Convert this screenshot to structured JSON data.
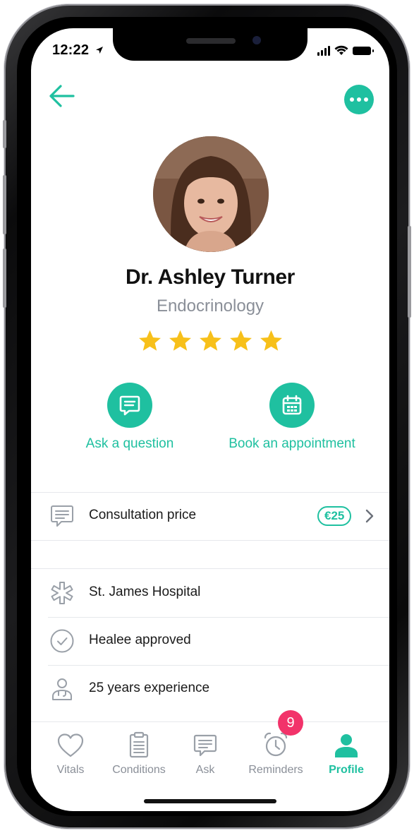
{
  "status_bar": {
    "time": "12:22"
  },
  "doctor": {
    "name": "Dr. Ashley Turner",
    "specialty": "Endocrinology",
    "rating": 5,
    "rating_max": 5
  },
  "actions": {
    "ask_label": "Ask a question",
    "book_label": "Book an appointment"
  },
  "details": {
    "consultation_label": "Consultation price",
    "consultation_price": "€25",
    "hospital": "St. James Hospital",
    "approved": "Healee approved",
    "experience": "25 years experience"
  },
  "tabs": [
    {
      "label": "Vitals",
      "icon": "heart-icon"
    },
    {
      "label": "Conditions",
      "icon": "clipboard-icon"
    },
    {
      "label": "Ask",
      "icon": "chat-icon"
    },
    {
      "label": "Reminders",
      "icon": "alarm-clock-icon",
      "badge": "9"
    },
    {
      "label": "Profile",
      "icon": "person-icon",
      "active": true
    }
  ],
  "colors": {
    "accent": "#1fc0a0",
    "star": "#f7c01a",
    "badge": "#f2336a",
    "muted": "#8a8f98"
  }
}
